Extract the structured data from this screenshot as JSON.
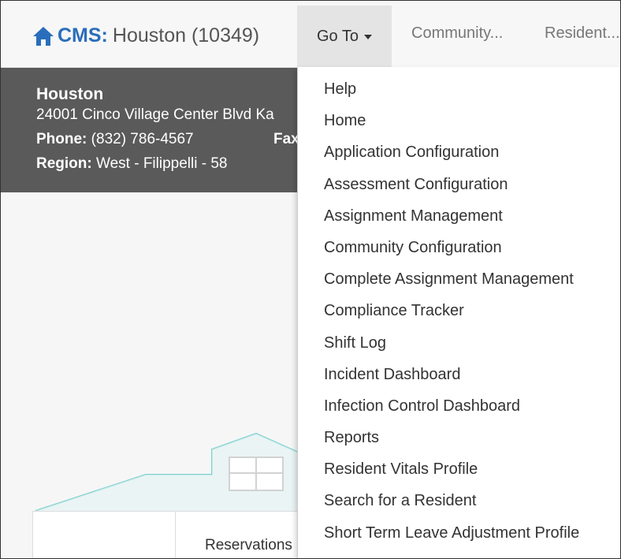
{
  "brand": {
    "prefix": "CMS:",
    "location": "Houston (10349)"
  },
  "nav": {
    "goto_label": "Go To",
    "community_label": "Community...",
    "resident_label": "Resident..."
  },
  "header": {
    "name": "Houston",
    "address": "24001 Cinco Village Center Blvd Ka",
    "phone_label": "Phone:",
    "phone_value": "(832) 786-4567",
    "fax_label": "Fax",
    "region_label": "Region:",
    "region_value": "West - Filippelli - 58"
  },
  "content": {
    "reservations_label": "Reservations"
  },
  "dropdown": {
    "items": [
      "Help",
      "Home",
      "Application Configuration",
      "Assessment Configuration",
      "Assignment Management",
      "Community Configuration",
      "Complete Assignment Management",
      "Compliance Tracker",
      "Shift Log",
      "Incident Dashboard",
      "Infection Control Dashboard",
      "Reports",
      "Resident Vitals Profile",
      "Search for a Resident",
      "Short Term Leave Adjustment Profile"
    ]
  },
  "colors": {
    "brand_blue": "#2a6ebb",
    "header_bg": "#5a5a5a",
    "illustration_teal": "#7fd0d0"
  },
  "icons": {
    "brand": "home-icon",
    "dropdown": "caret-down-icon"
  }
}
